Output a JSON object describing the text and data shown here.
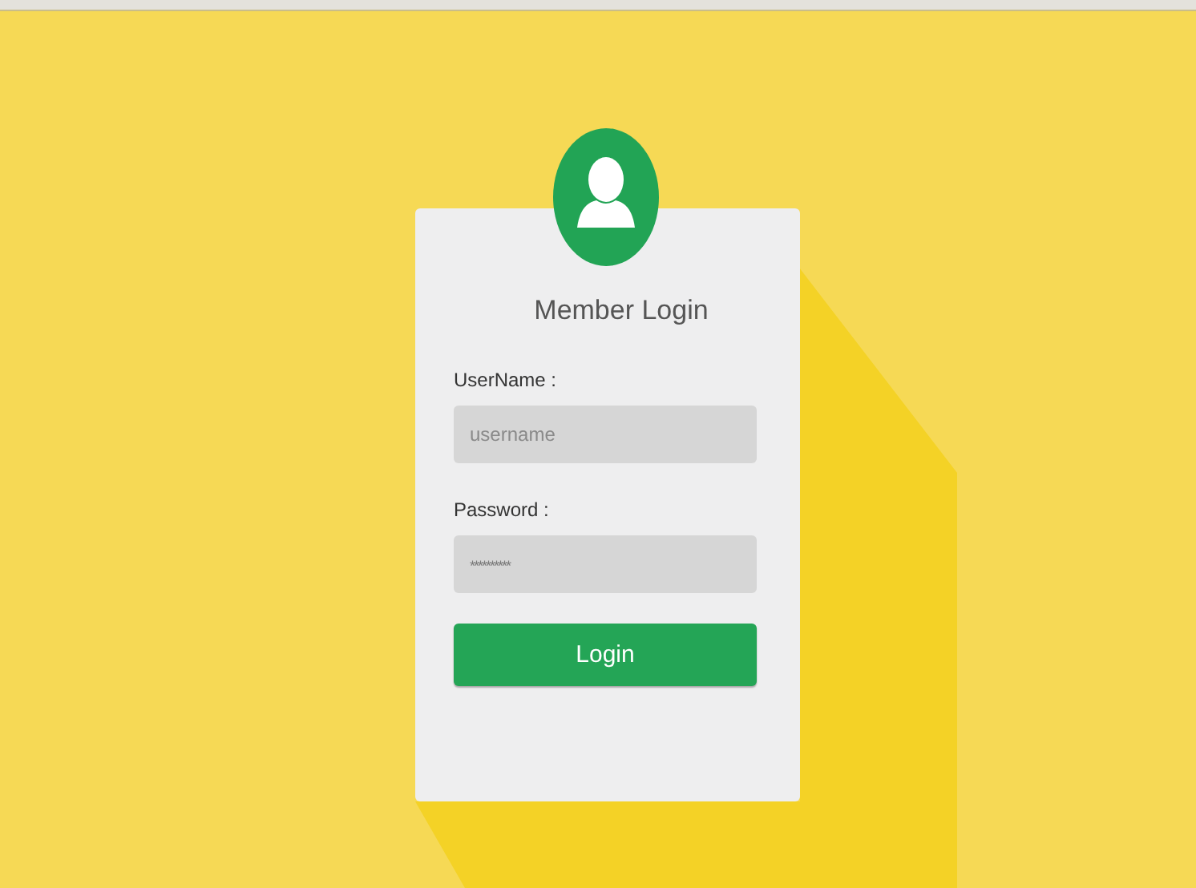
{
  "title": "Member Login",
  "fields": [
    {
      "label": "UserName :",
      "placeholder": "username",
      "kind": "text"
    },
    {
      "label": "Password :",
      "placeholder": "**********",
      "kind": "password"
    }
  ],
  "button": "Login"
}
